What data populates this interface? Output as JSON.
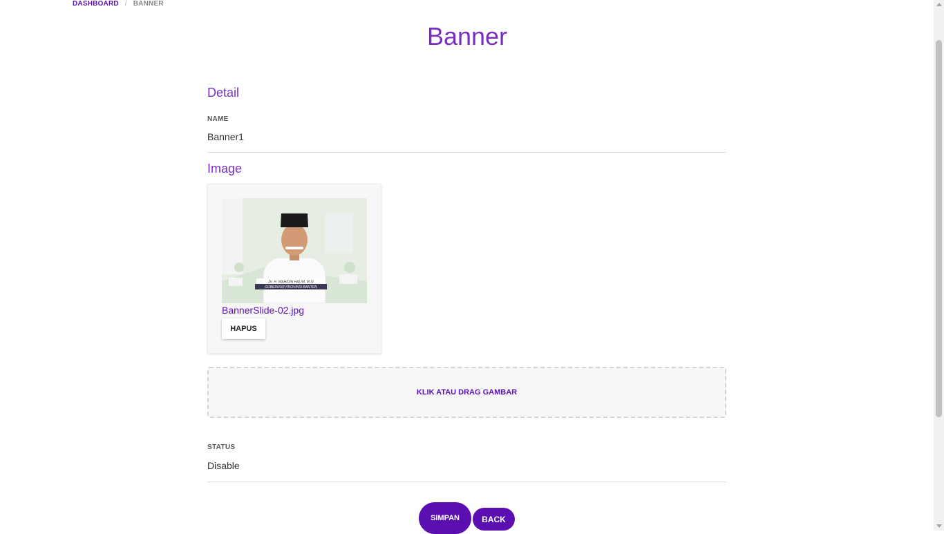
{
  "breadcrumb": {
    "items": [
      {
        "label": "DASHBOARD"
      },
      {
        "label": "BANNER"
      }
    ],
    "separator": "/"
  },
  "page": {
    "title": "Banner"
  },
  "form": {
    "detail_section": "Detail",
    "name": {
      "label": "NAME",
      "value": "Banner1"
    },
    "image_section": "Image",
    "image": {
      "file_name": "BannerSlide-02.jpg",
      "delete_label": "HAPUS",
      "caption_name": "Dr. H. WAHIDIN HALIM, M.Si",
      "caption_title": "GUBERNUR PROVINSI BANTEN"
    },
    "dropzone_label": "KLIK ATAU DRAG GAMBAR",
    "status": {
      "label": "STATUS",
      "value": "Disable"
    }
  },
  "actions": {
    "save_label": "SIMPAN",
    "back_label": "BACK"
  },
  "colors": {
    "accent": "#5b0fb1",
    "title": "#7a2fc0"
  }
}
